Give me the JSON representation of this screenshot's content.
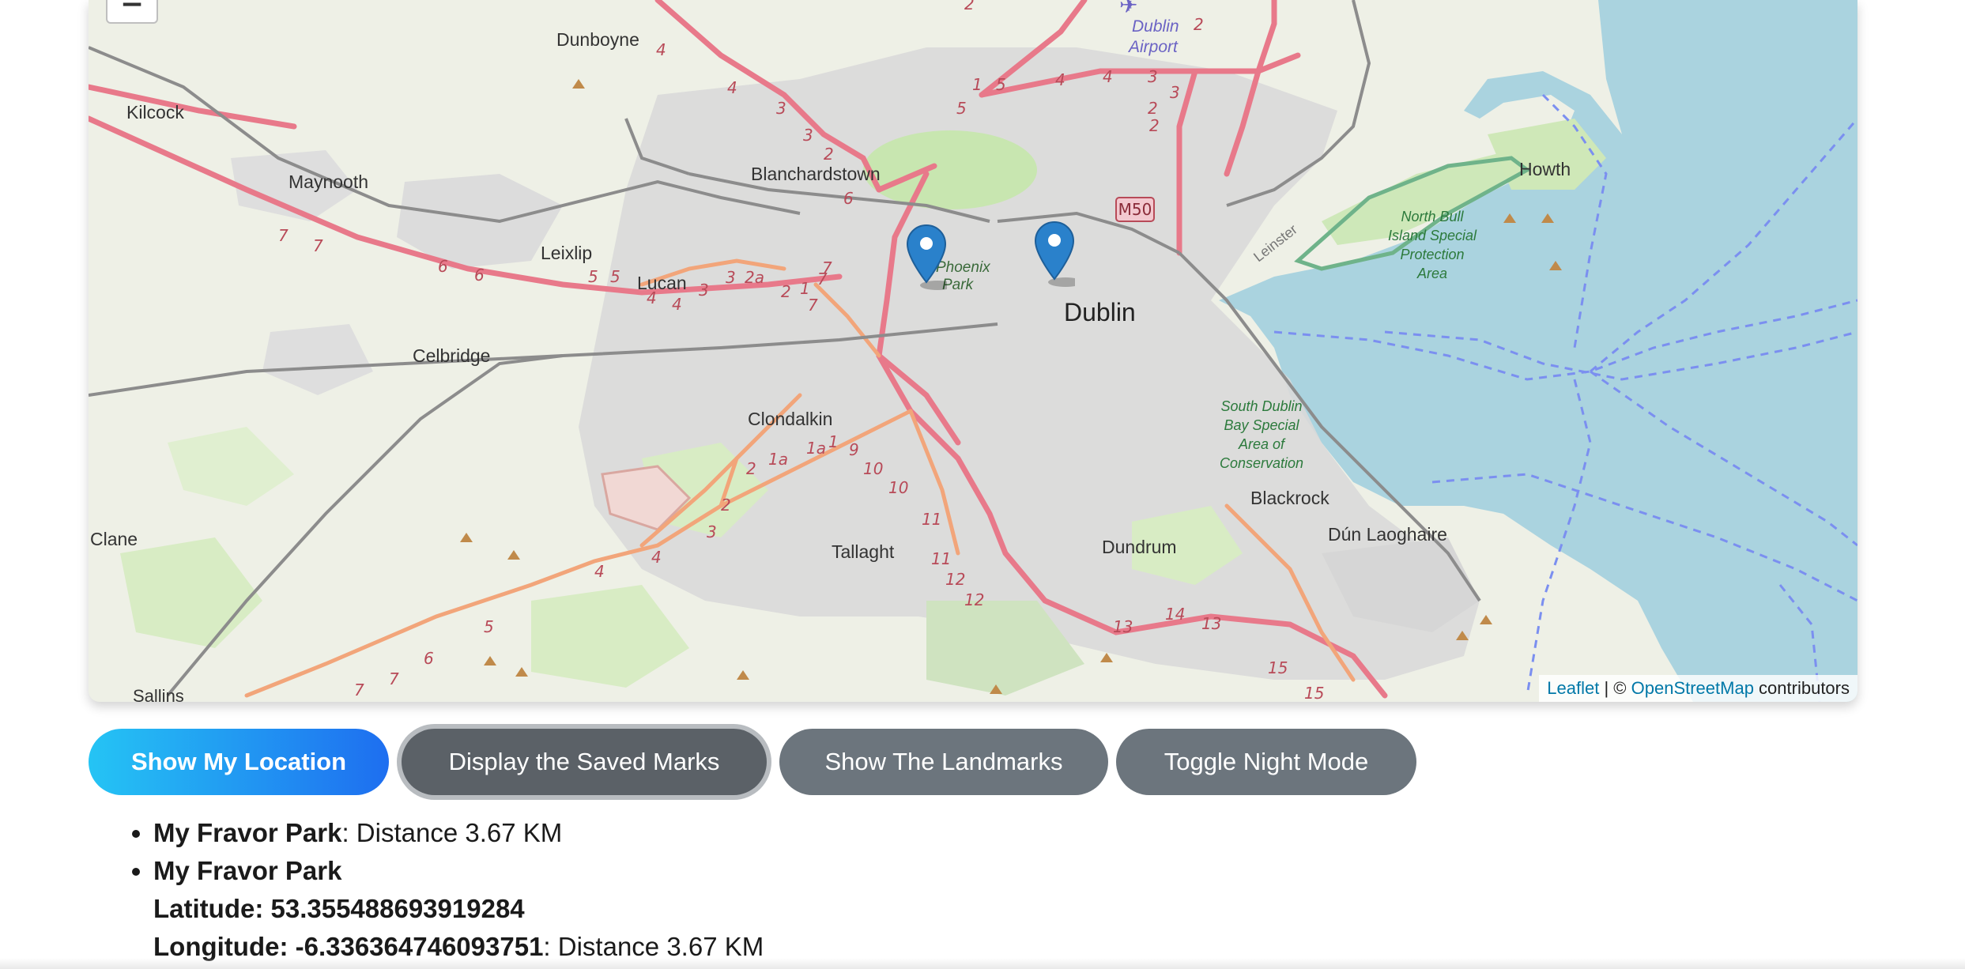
{
  "map": {
    "zoom_out_label": "−",
    "attribution": {
      "leaflet": "Leaflet",
      "separator": " | © ",
      "osm": "OpenStreetMap",
      "contributors": " contributors"
    },
    "places": {
      "dunboyne": "Dunboyne",
      "airport1": "Dublin",
      "airport2": "Airport",
      "kilcock": "Kilcock",
      "maynooth": "Maynooth",
      "blanchardstown": "Blanchardstown",
      "howth": "Howth",
      "m50": "M50",
      "leixlip": "Leixlip",
      "lucan": "Lucan",
      "dublin": "Dublin",
      "phoenix1": "Phoenix",
      "phoenix2": "Park",
      "celbridge": "Celbridge",
      "clondalkin": "Clondalkin",
      "blackrock": "Blackrock",
      "dunlaoghaire": "Dún Laoghaire",
      "tallaght": "Tallaght",
      "dundrum": "Dundrum",
      "clane": "Clane",
      "sallins": "Sallins",
      "leinster": "Leinster",
      "nbi1": "North Bull",
      "nbi2": "Island Special",
      "nbi3": "Protection",
      "nbi4": "Area",
      "sdb1": "South Dublin",
      "sdb2": "Bay Special",
      "sdb3": "Area of",
      "sdb4": "Conservation"
    },
    "colors": {
      "land": "#eef0e6",
      "sea": "#aad3df",
      "urban": "#d9d9d9",
      "park": "#c8e6b0",
      "motorway": "#e8798a",
      "primary": "#f2a57a",
      "marker": "#2a81cb"
    }
  },
  "buttons": {
    "show_location": "Show My Location",
    "display_saved": "Display the Saved Marks",
    "show_landmarks": "Show The Landmarks",
    "toggle_night": "Toggle Night Mode"
  },
  "saved_marks": [
    {
      "name": "My Fravor Park",
      "distance": ": Distance 3.67 KM"
    },
    {
      "name": "My Fravor Park",
      "latitude_label": "Latitude: 53.355488693919284",
      "longitude_label": "Longitude: -6.336364746093751",
      "distance": ": Distance 3.67 KM"
    }
  ]
}
